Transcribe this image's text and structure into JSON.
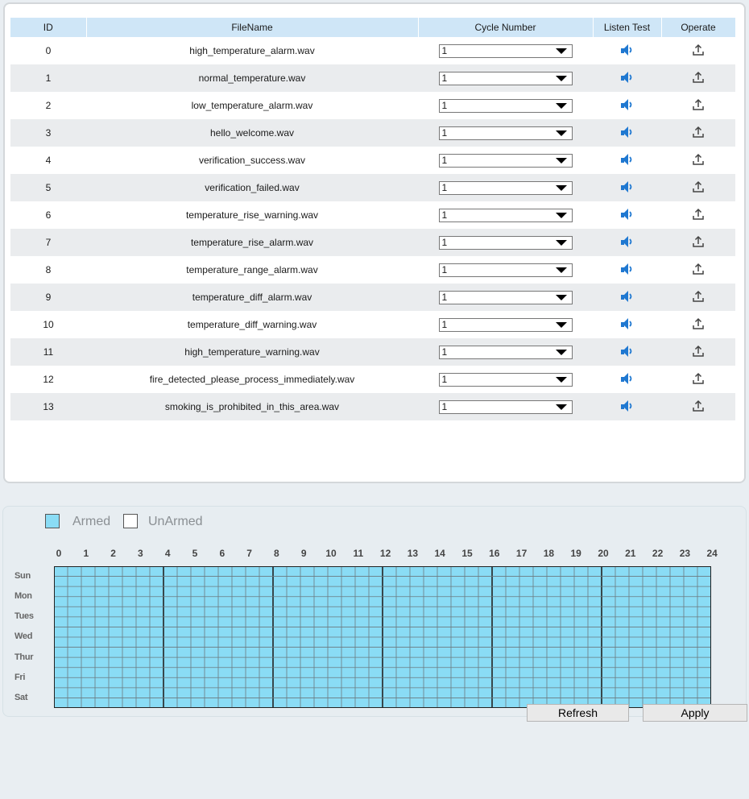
{
  "table": {
    "headers": [
      "ID",
      "FileName",
      "Cycle Number",
      "Listen Test",
      "Operate"
    ],
    "rows": [
      {
        "id": "0",
        "file": "high_temperature_alarm.wav",
        "cycle": "1"
      },
      {
        "id": "1",
        "file": "normal_temperature.wav",
        "cycle": "1"
      },
      {
        "id": "2",
        "file": "low_temperature_alarm.wav",
        "cycle": "1"
      },
      {
        "id": "3",
        "file": "hello_welcome.wav",
        "cycle": "1"
      },
      {
        "id": "4",
        "file": "verification_success.wav",
        "cycle": "1"
      },
      {
        "id": "5",
        "file": "verification_failed.wav",
        "cycle": "1"
      },
      {
        "id": "6",
        "file": "temperature_rise_warning.wav",
        "cycle": "1"
      },
      {
        "id": "7",
        "file": "temperature_rise_alarm.wav",
        "cycle": "1"
      },
      {
        "id": "8",
        "file": "temperature_range_alarm.wav",
        "cycle": "1"
      },
      {
        "id": "9",
        "file": "temperature_diff_alarm.wav",
        "cycle": "1"
      },
      {
        "id": "10",
        "file": "temperature_diff_warning.wav",
        "cycle": "1"
      },
      {
        "id": "11",
        "file": "high_temperature_warning.wav",
        "cycle": "1"
      },
      {
        "id": "12",
        "file": "fire_detected_please_process_immediately.wav",
        "cycle": "1"
      },
      {
        "id": "13",
        "file": "smoking_is_prohibited_in_this_area.wav",
        "cycle": "1"
      }
    ],
    "icons": {
      "listen": "speaker-icon",
      "operate": "upload-icon"
    }
  },
  "schedule": {
    "legend": {
      "armed": "Armed",
      "unarmed": "UnArmed"
    },
    "hours": [
      "0",
      "1",
      "2",
      "3",
      "4",
      "5",
      "6",
      "7",
      "8",
      "9",
      "10",
      "11",
      "12",
      "13",
      "14",
      "15",
      "16",
      "17",
      "18",
      "19",
      "20",
      "21",
      "22",
      "23",
      "24"
    ],
    "days": [
      "Sun",
      "Mon",
      "Tues",
      "Wed",
      "Thur",
      "Fri",
      "Sat"
    ],
    "armed_fraction": 1.0
  },
  "buttons": {
    "refresh": "Refresh",
    "apply": "Apply"
  },
  "colors": {
    "header_bg": "#cfe6f7",
    "armed": "#8adcf5",
    "icon_blue": "#1f78d1",
    "page_bg": "#e9eef2"
  }
}
